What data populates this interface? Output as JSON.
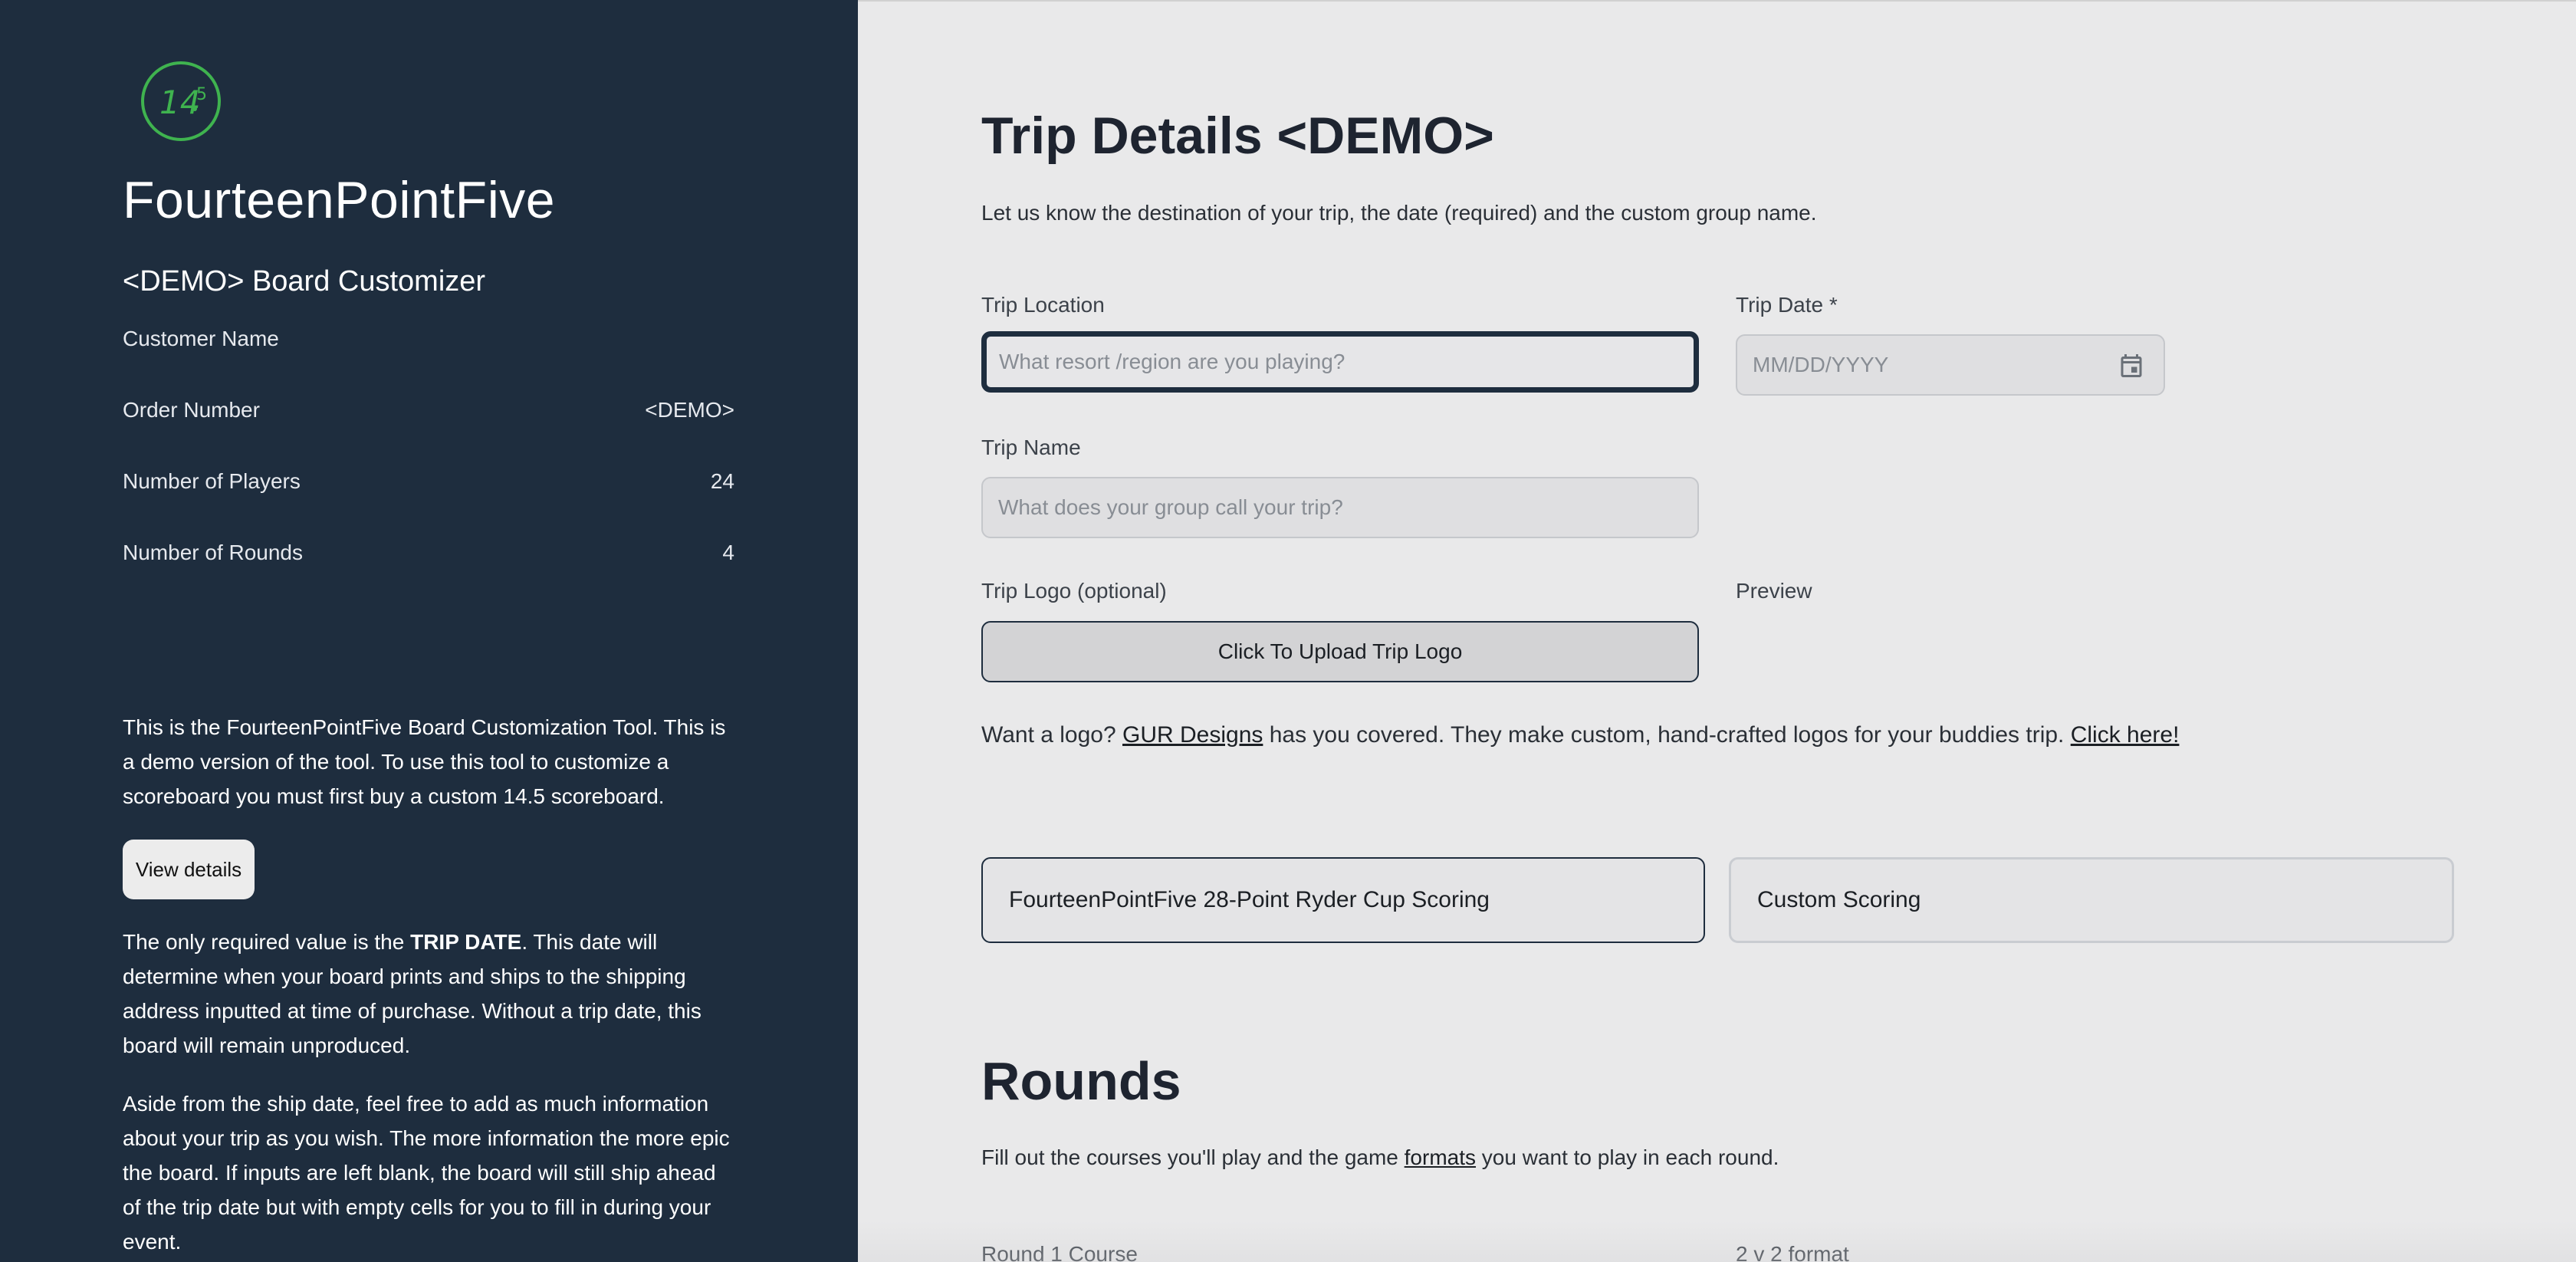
{
  "sidebar": {
    "brand": "FourteenPointFive",
    "logo_text": "14.5",
    "subtitle": "<DEMO> Board Customizer",
    "rows": [
      {
        "label": "Customer Name",
        "value": ""
      },
      {
        "label": "Order Number",
        "value": "<DEMO>"
      },
      {
        "label": "Number of Players",
        "value": "24"
      },
      {
        "label": "Number of Rounds",
        "value": "4"
      }
    ],
    "desc1": "This is the FourteenPointFive Board Customization Tool. This is a demo version of the tool. To use this tool to customize a scoreboard you must first buy a custom 14.5 scoreboard.",
    "view_details": "View details",
    "desc2_pre": "The only required value is the ",
    "desc2_bold": "TRIP DATE",
    "desc2_post": ". This date will determine when your board prints and ships to the shipping address inputted at time of purchase. Without a trip date, this board will remain unproduced.",
    "desc3": "Aside from the ship date, feel free to add as much information about your trip as you wish. The more information the more epic the board. If inputs are left blank, the board will still ship ahead of the trip date but with empty cells for you to fill in during your event."
  },
  "main": {
    "title": "Trip Details <DEMO>",
    "lead": "Let us know the destination of your trip, the date (required) and the custom group name.",
    "trip_location_label": "Trip Location",
    "trip_location_placeholder": "What resort /region are you playing?",
    "trip_date_label": "Trip Date *",
    "trip_date_placeholder": "MM/DD/YYYY",
    "trip_name_label": "Trip Name",
    "trip_name_placeholder": "What does your group call your trip?",
    "trip_logo_label": "Trip Logo (optional)",
    "preview_label": "Preview",
    "upload_label": "Click To Upload Trip Logo",
    "promo_pre": "Want a logo? ",
    "promo_link": "GUR Designs",
    "promo_mid": " has you covered. They make custom, hand-crafted logos for your buddies trip. ",
    "promo_cta": "Click here!",
    "scoring_option_1": "FourteenPointFive 28-Point Ryder Cup Scoring",
    "scoring_option_2": "Custom Scoring",
    "rounds_title": "Rounds",
    "rounds_lead_pre": "Fill out the courses you'll play and the game ",
    "rounds_lead_link": "formats",
    "rounds_lead_post": " you want to play in each round.",
    "round1_course_label": "Round 1 Course",
    "round1_format_label": "2 v 2 format"
  },
  "colors": {
    "sidebar_bg": "#1e2d3e",
    "main_bg": "#e9e9ea",
    "logo_green": "#3fb34f"
  }
}
